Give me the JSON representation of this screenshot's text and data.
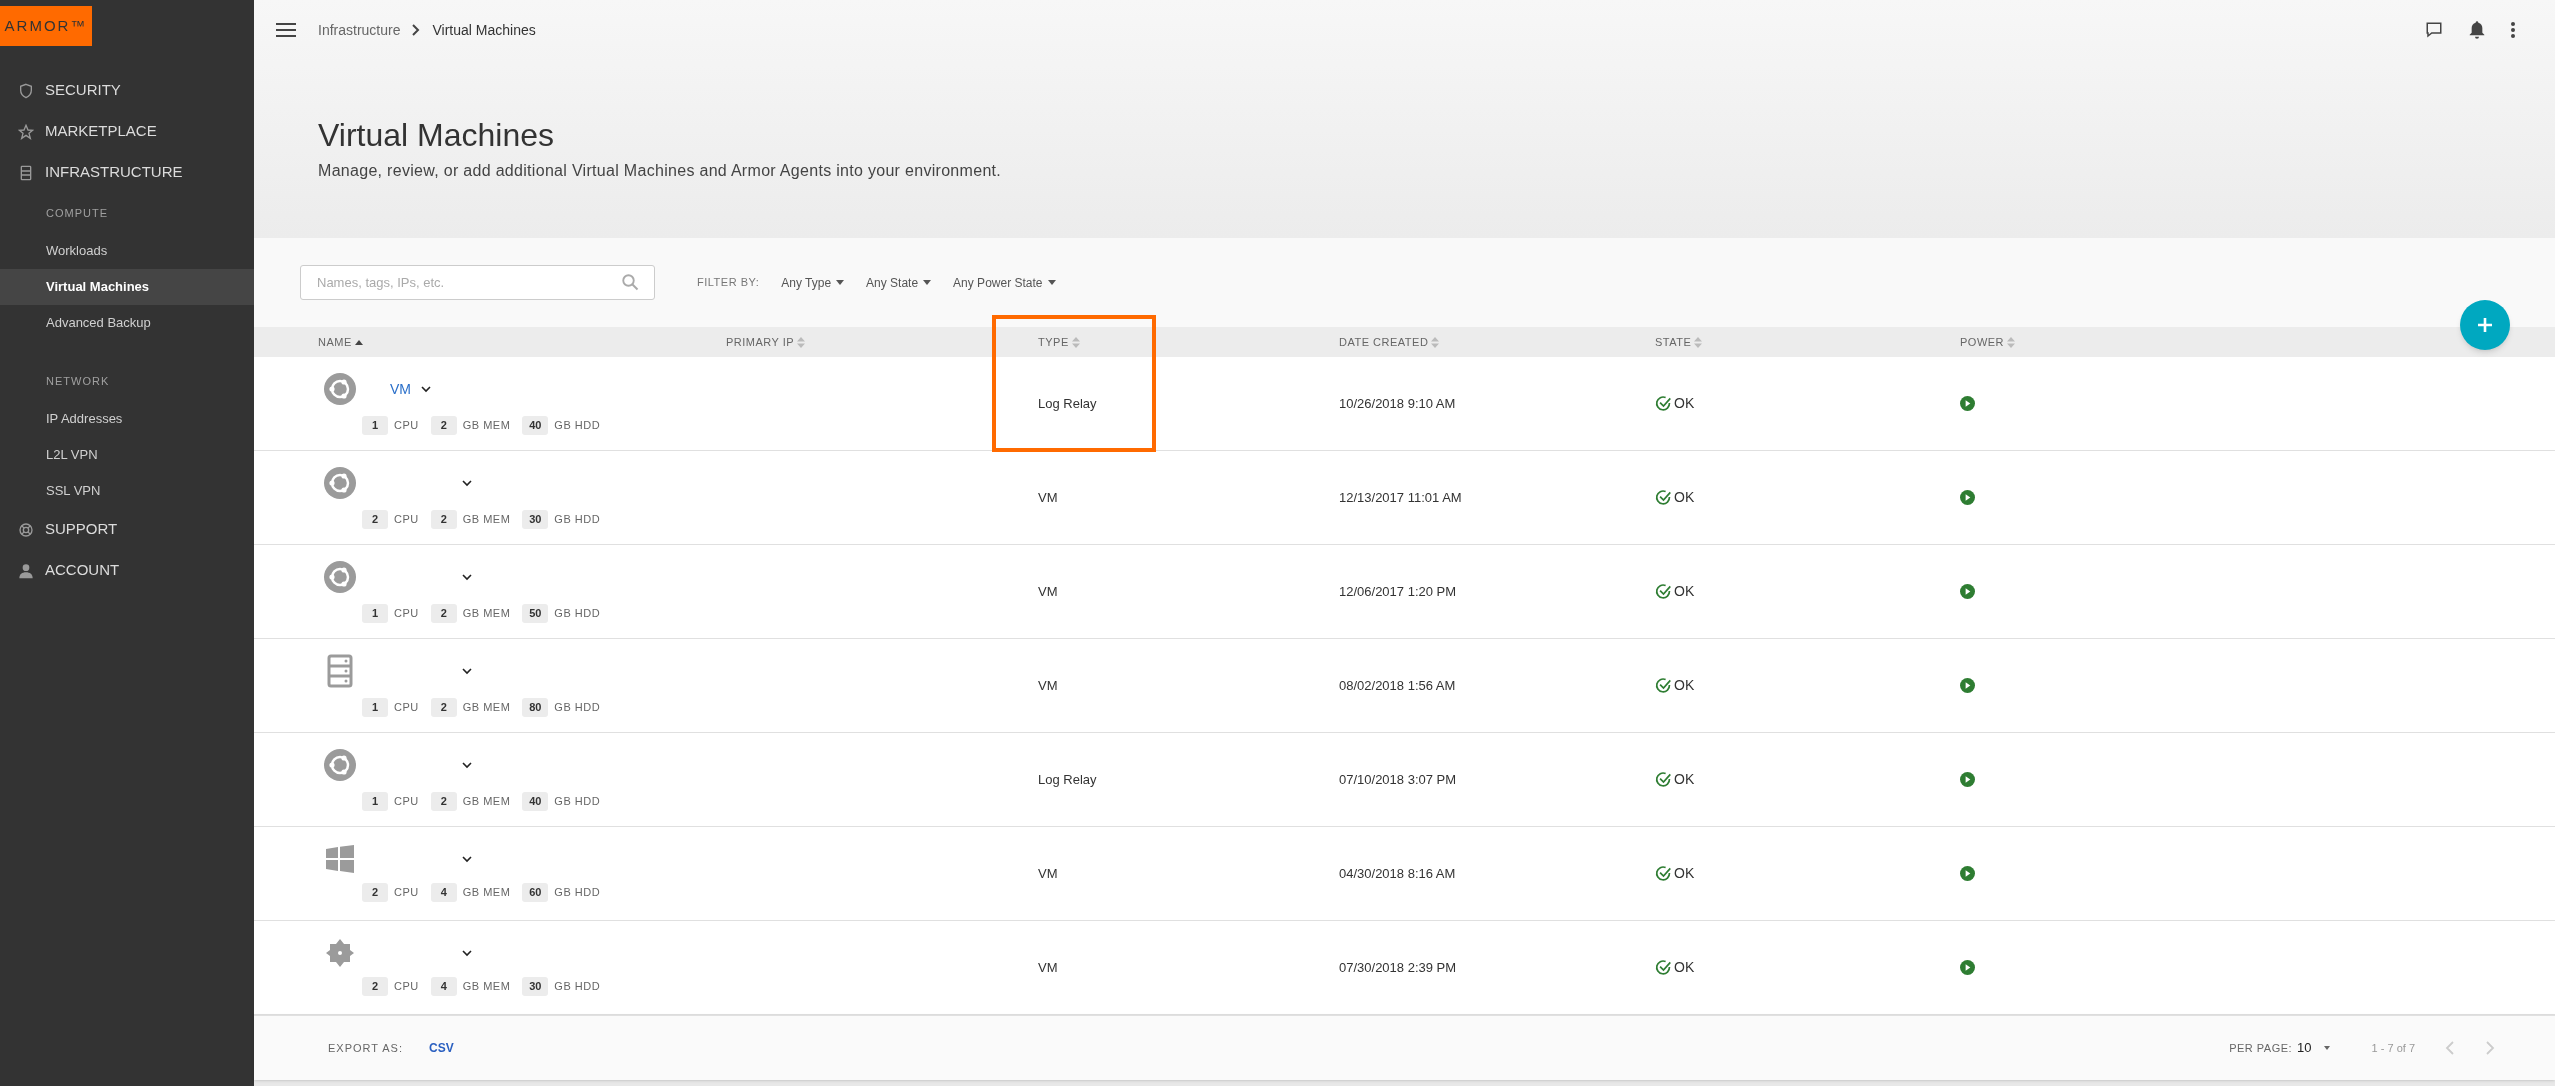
{
  "logo": "ARMOR™",
  "nav": [
    {
      "label": "SECURITY",
      "selected": false
    },
    {
      "label": "MARKETPLACE",
      "selected": false
    },
    {
      "label": "INFRASTRUCTURE",
      "selected": false,
      "groups": [
        {
          "heading": "COMPUTE",
          "items": [
            {
              "label": "Workloads",
              "selected": false
            },
            {
              "label": "Virtual Machines",
              "selected": true
            },
            {
              "label": "Advanced Backup",
              "selected": false
            }
          ]
        },
        {
          "heading": "NETWORK",
          "items": [
            {
              "label": "IP Addresses",
              "selected": false
            },
            {
              "label": "L2L VPN",
              "selected": false
            },
            {
              "label": "SSL VPN",
              "selected": false
            }
          ]
        }
      ]
    },
    {
      "label": "SUPPORT",
      "selected": false
    },
    {
      "label": "ACCOUNT",
      "selected": false
    }
  ],
  "breadcrumb": [
    "Infrastructure",
    "Virtual Machines"
  ],
  "page": {
    "title": "Virtual Machines",
    "subtitle": "Manage, review, or add additional Virtual Machines and Armor Agents into your environment."
  },
  "search": {
    "placeholder": "Names, tags, IPs, etc."
  },
  "filter_label": "FILTER BY:",
  "filters": [
    "Any Type",
    "Any State",
    "Any Power State"
  ],
  "columns": [
    {
      "label": "NAME",
      "sorted": true,
      "highlighted": false
    },
    {
      "label": "PRIMARY IP",
      "sorted": false,
      "highlighted": false
    },
    {
      "label": "TYPE",
      "sorted": false,
      "highlighted": true
    },
    {
      "label": "DATE CREATED",
      "sorted": false,
      "highlighted": false
    },
    {
      "label": "STATE",
      "sorted": false,
      "highlighted": false
    },
    {
      "label": "POWER",
      "sorted": false,
      "highlighted": false
    }
  ],
  "rows": [
    {
      "kind": "ubuntu",
      "name": "VM",
      "expanded": false,
      "specs": [
        {
          "value": "1",
          "unit": "CPU"
        },
        {
          "value": "2",
          "unit": "GB MEM"
        },
        {
          "value": "40",
          "unit": "GB HDD"
        }
      ],
      "type": "Log Relay",
      "date": "10/26/2018 9:10 AM",
      "state": "OK",
      "power_on": true
    },
    {
      "kind": "ubuntu",
      "expanded": false,
      "specs": [
        {
          "value": "2",
          "unit": "CPU"
        },
        {
          "value": "2",
          "unit": "GB MEM"
        },
        {
          "value": "30",
          "unit": "GB HDD"
        }
      ],
      "type": "VM",
      "date": "12/13/2017 11:01 AM",
      "state": "OK",
      "power_on": true
    },
    {
      "kind": "ubuntu",
      "expanded": false,
      "specs": [
        {
          "value": "1",
          "unit": "CPU"
        },
        {
          "value": "2",
          "unit": "GB MEM"
        },
        {
          "value": "50",
          "unit": "GB HDD"
        }
      ],
      "type": "VM",
      "date": "12/06/2017 1:20 PM",
      "state": "OK",
      "power_on": true
    },
    {
      "kind": "server",
      "expanded": false,
      "specs": [
        {
          "value": "1",
          "unit": "CPU"
        },
        {
          "value": "2",
          "unit": "GB MEM"
        },
        {
          "value": "80",
          "unit": "GB HDD"
        }
      ],
      "type": "VM",
      "date": "08/02/2018 1:56 AM",
      "state": "OK",
      "power_on": true
    },
    {
      "kind": "ubuntu",
      "expanded": false,
      "specs": [
        {
          "value": "1",
          "unit": "CPU"
        },
        {
          "value": "2",
          "unit": "GB MEM"
        },
        {
          "value": "40",
          "unit": "GB HDD"
        }
      ],
      "type": "Log Relay",
      "date": "07/10/2018 3:07 PM",
      "state": "OK",
      "power_on": true
    },
    {
      "kind": "windows",
      "expanded": false,
      "specs": [
        {
          "value": "2",
          "unit": "CPU"
        },
        {
          "value": "4",
          "unit": "GB MEM"
        },
        {
          "value": "60",
          "unit": "GB HDD"
        }
      ],
      "type": "VM",
      "date": "04/30/2018 8:16 AM",
      "state": "OK",
      "power_on": true
    },
    {
      "kind": "centos",
      "expanded": false,
      "specs": [
        {
          "value": "2",
          "unit": "CPU"
        },
        {
          "value": "4",
          "unit": "GB MEM"
        },
        {
          "value": "30",
          "unit": "GB HDD"
        }
      ],
      "type": "VM",
      "date": "07/30/2018 2:39 PM",
      "state": "OK",
      "power_on": true
    }
  ],
  "footer": {
    "export_label": "EXPORT AS:",
    "export_link": "CSV",
    "per_page_label": "PER PAGE:",
    "per_page": "10",
    "range": "1 - 7 of 7"
  }
}
